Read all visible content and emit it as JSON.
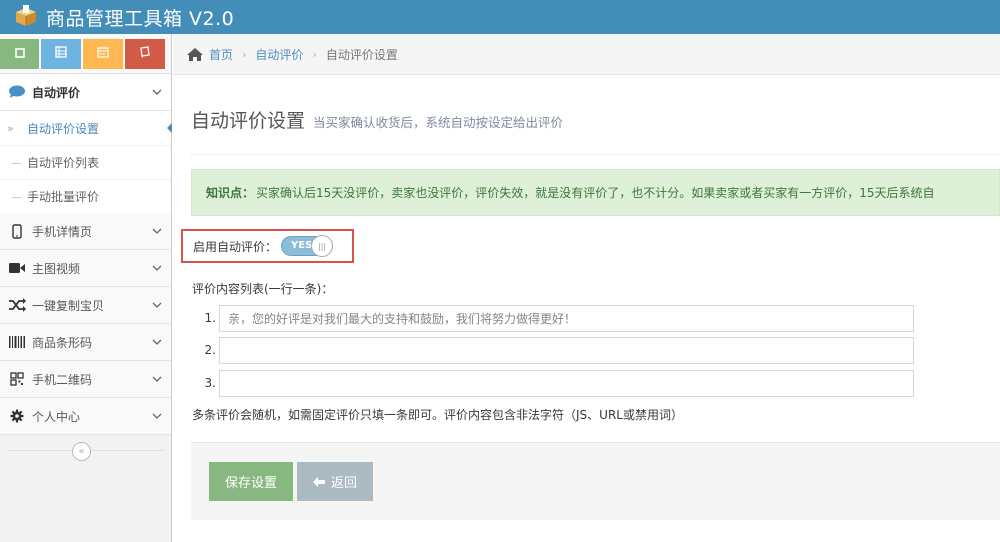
{
  "header": {
    "title": "商品管理工具箱 V2.0"
  },
  "colors": {
    "header_bg": "#438eb9",
    "shortcut_green": "#87b87f",
    "shortcut_blue": "#6fb3e0",
    "shortcut_orange": "#ffb752",
    "shortcut_red": "#d15b47",
    "alert_bg": "#dff0d8",
    "highlight_border": "#d9534f"
  },
  "sidebar": {
    "shortcuts": [
      {
        "icon": "square-icon"
      },
      {
        "icon": "grid-icon"
      },
      {
        "icon": "calendar-icon"
      },
      {
        "icon": "book-icon"
      }
    ],
    "items": [
      {
        "label": "自动评价",
        "icon": "comment-icon",
        "open": true,
        "children": [
          {
            "label": "自动评价设置",
            "active": true
          },
          {
            "label": "自动评价列表"
          },
          {
            "label": "手动批量评价"
          }
        ]
      },
      {
        "label": "手机详情页",
        "icon": "mobile-icon"
      },
      {
        "label": "主图视频",
        "icon": "video-icon"
      },
      {
        "label": "一键复制宝贝",
        "icon": "shuffle-icon"
      },
      {
        "label": "商品条形码",
        "icon": "barcode-icon"
      },
      {
        "label": "手机二维码",
        "icon": "qrcode-icon"
      },
      {
        "label": "个人中心",
        "icon": "gear-icon"
      }
    ],
    "collapse_symbol": "«"
  },
  "breadcrumbs": {
    "home": "首页",
    "section": "自动评价",
    "current": "自动评价设置",
    "separator": "›"
  },
  "page": {
    "title": "自动评价设置",
    "subtitle": "当买家确认收货后，系统自动按设定给出评价",
    "alert": {
      "label": "知识点：",
      "text": "买家确认后15天没评价，卖家也没评价，评价失效，就是没有评价了，也不计分。如果卖家或者买家有一方评价，15天后系统自"
    },
    "toggle": {
      "label": "启用自动评价：",
      "state_text": "YES",
      "enabled": true
    },
    "list_label": "评价内容列表(一行一条)：",
    "rows": [
      {
        "num": "1.",
        "value": "亲，您的好评是对我们最大的支持和鼓励，我们将努力做得更好！"
      },
      {
        "num": "2.",
        "value": ""
      },
      {
        "num": "3.",
        "value": ""
      }
    ],
    "hint": "多条评价会随机，如需固定评价只填一条即可。评价内容包含非法字符（JS、URL或禁用词）",
    "buttons": {
      "save": "保存设置",
      "back": "返回"
    }
  }
}
